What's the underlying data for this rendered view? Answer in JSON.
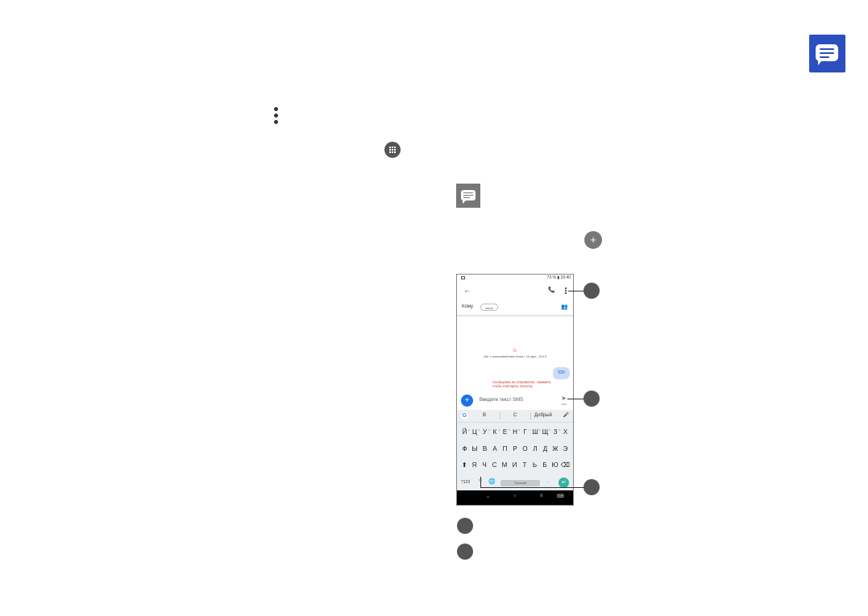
{
  "icons": {
    "app": "messages-app-icon",
    "menu": "more-vert-icon",
    "apps": "apps-grid-icon",
    "messages_small": "messages-icon",
    "start_chat": "add-icon"
  },
  "colors": {
    "app_icon_bg": "#2b4fbf",
    "fab": "#1a73e8",
    "error": "#d32f2f",
    "outgoing_bubble": "#c9ddf7",
    "enter_key": "#33b5a0"
  },
  "phone": {
    "status": {
      "right": "73 % ▮ 16:40"
    },
    "to_label": "Кому",
    "recipient_chip": "Anna",
    "flower": "✿",
    "chat_meta": "Чат с пользователем Anna • 14 дек., 15:13",
    "outgoing_message": "520",
    "error_line1": "Сообщение не отправлено. Нажмите,",
    "error_line2": "чтобы повторить попытку.",
    "input_placeholder": "Введите текст SMS",
    "send_sub": "SMS",
    "keyboard": {
      "suggestions": [
        "В",
        "С",
        "Добрый"
      ],
      "row1": [
        "Й",
        "Ц",
        "У",
        "К",
        "Е",
        "Н",
        "Г",
        "Ш",
        "Щ",
        "З",
        "Х"
      ],
      "row1_hints": [
        "1",
        "2",
        "3",
        "4",
        "5",
        "6",
        "7",
        "8",
        "9",
        "0",
        ""
      ],
      "row2": [
        "Ф",
        "Ы",
        "В",
        "А",
        "П",
        "Р",
        "О",
        "Л",
        "Д",
        "Ж",
        "Э"
      ],
      "row3": [
        "Я",
        "Ч",
        "С",
        "М",
        "И",
        "Т",
        "Ь",
        "Б",
        "Ю"
      ],
      "symbols_key": "?123",
      "space_label": "Русский",
      "period_key": "."
    }
  }
}
